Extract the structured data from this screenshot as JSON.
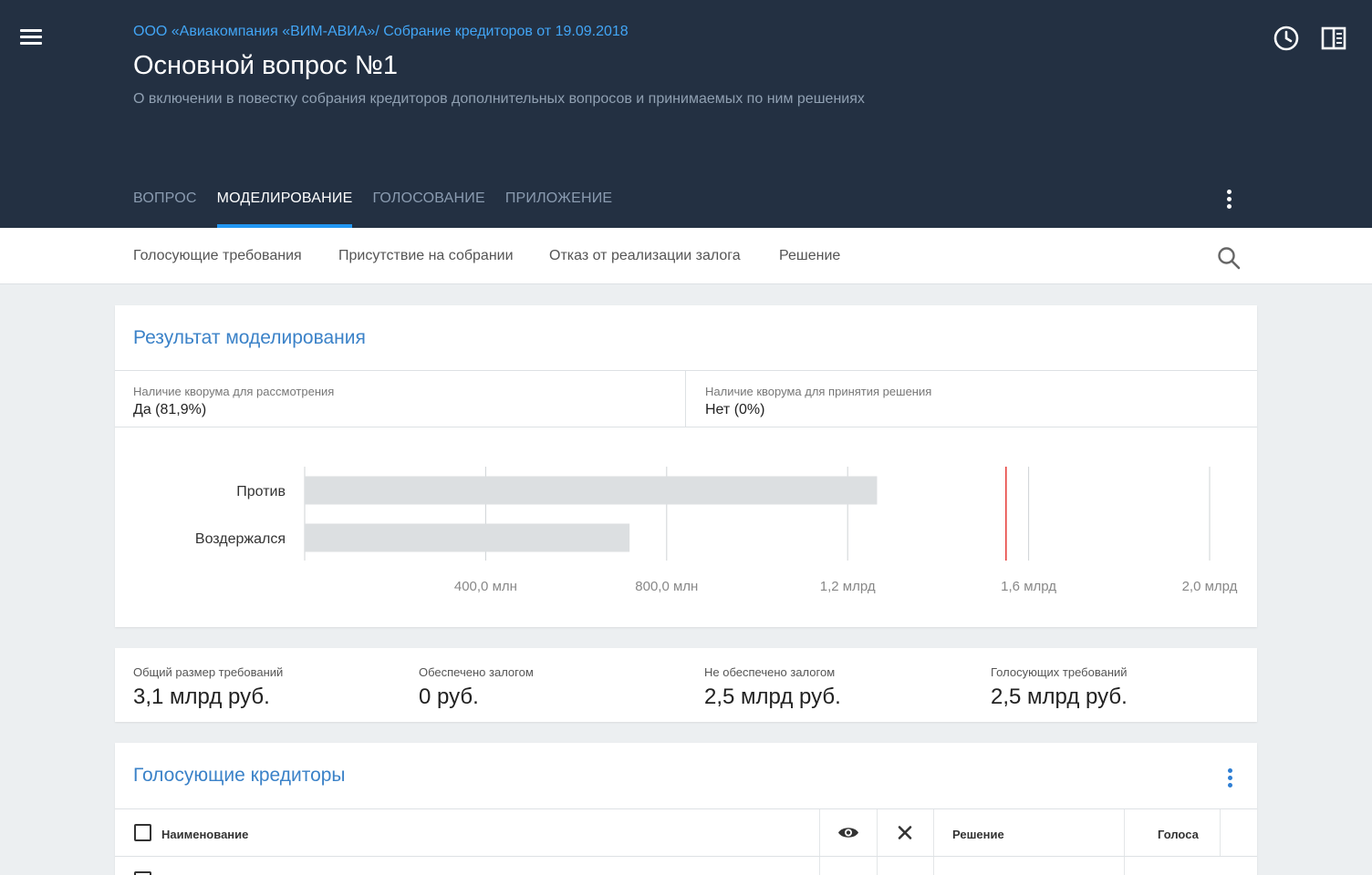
{
  "header": {
    "breadcrumb": "ООО «Авиакомпания «ВИМ-АВИА»/ Собрание кредиторов от 19.09.2018",
    "title": "Основной вопрос №1",
    "subtitle": "О включении в повестку собрания кредиторов дополнительных вопросов и принимаемых по ним решениях",
    "tabs": [
      {
        "label": "ВОПРОС"
      },
      {
        "label": "МОДЕЛИРОВАНИЕ"
      },
      {
        "label": "ГОЛОСОВАНИЕ"
      },
      {
        "label": "ПРИЛОЖЕНИЕ"
      }
    ],
    "active_tab": "МОДЕЛИРОВАНИЕ"
  },
  "subnav": {
    "items": [
      {
        "label": "Голосующие требования"
      },
      {
        "label": "Присутствие на собрании"
      },
      {
        "label": "Отказ от реализации залога"
      },
      {
        "label": "Решение"
      }
    ]
  },
  "result": {
    "title": "Результат моделирования",
    "quorum_review_label": "Наличие кворума для рассмотрения",
    "quorum_review_value": "Да (81,9%)",
    "quorum_decision_label": "Наличие кворума для принятия решения",
    "quorum_decision_value": "Нет (0%)"
  },
  "chart_data": {
    "type": "bar",
    "orientation": "horizontal",
    "categories": [
      "Против",
      "Воздержался"
    ],
    "values": [
      1265000000,
      718000000
    ],
    "xlim": [
      0,
      2000000000
    ],
    "xticks": [
      400000000,
      800000000,
      1200000000,
      1600000000,
      2000000000
    ],
    "xtick_labels": [
      "400,0 млн",
      "800,0 млн",
      "1,2 млрд",
      "1,6 млрд",
      "2,0 млрд"
    ],
    "threshold": 1550000000,
    "threshold_color": "#e53935",
    "bar_color": "#dcdfe1",
    "grid": true
  },
  "stats": [
    {
      "label": "Общий размер требований",
      "value": "3,1 млрд руб."
    },
    {
      "label": "Обеспечено залогом",
      "value": "0 руб."
    },
    {
      "label": "Не обеспечено залогом",
      "value": "2,5 млрд руб."
    },
    {
      "label": "Голосующих требований",
      "value": "2,5 млрд руб."
    }
  ],
  "creditors": {
    "title": "Голосующие кредиторы",
    "columns": {
      "name": "Наименование",
      "decision": "Решение",
      "votes": "Голоса"
    }
  },
  "colors": {
    "header_bg": "#233042",
    "accent": "#2196f3",
    "link": "#42a5f5",
    "card_title": "#3b82c8"
  }
}
